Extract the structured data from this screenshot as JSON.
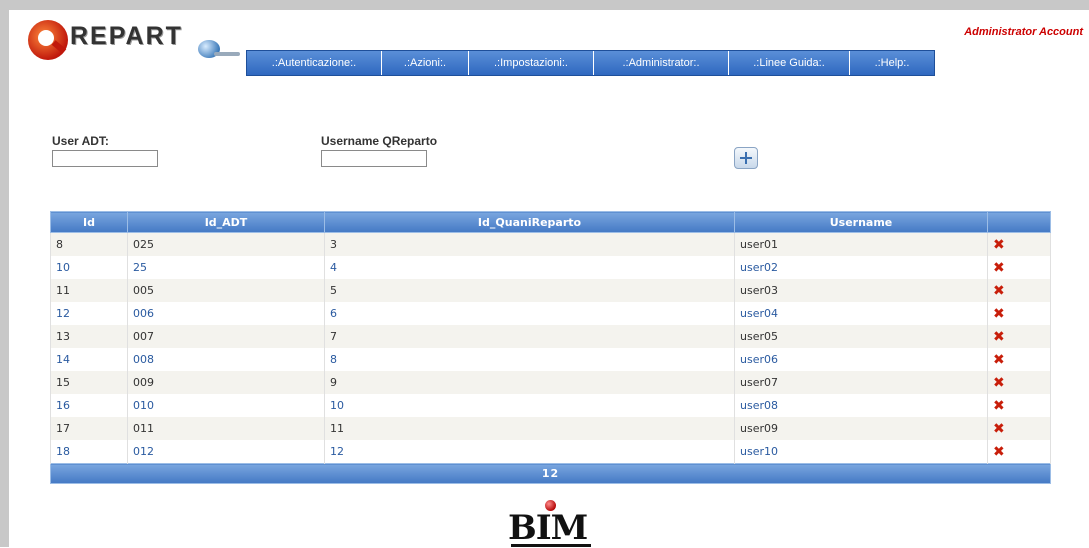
{
  "app": {
    "logo_text": "REPART",
    "account_label": "Administrator Account"
  },
  "menu": [
    {
      "label": ".:Autenticazione:."
    },
    {
      "label": ".:Azioni:."
    },
    {
      "label": ".:Impostazioni:."
    },
    {
      "label": ".:Administrator:."
    },
    {
      "label": ".:Linee Guida:."
    },
    {
      "label": ".:Help:."
    }
  ],
  "form": {
    "user_adt_label": "User ADT:",
    "user_adt_value": "",
    "username_label": "Username QReparto",
    "username_value": "",
    "add_button_icon": "plus-icon"
  },
  "table": {
    "columns": [
      "Id",
      "Id_ADT",
      "Id_QuaniReparto",
      "Username",
      ""
    ],
    "rows": [
      {
        "id": "8",
        "id_adt": "025",
        "id_q": "3",
        "username": "user01"
      },
      {
        "id": "10",
        "id_adt": "25",
        "id_q": "4",
        "username": "user02"
      },
      {
        "id": "11",
        "id_adt": "005",
        "id_q": "5",
        "username": "user03"
      },
      {
        "id": "12",
        "id_adt": "006",
        "id_q": "6",
        "username": "user04"
      },
      {
        "id": "13",
        "id_adt": "007",
        "id_q": "7",
        "username": "user05"
      },
      {
        "id": "14",
        "id_adt": "008",
        "id_q": "8",
        "username": "user06"
      },
      {
        "id": "15",
        "id_adt": "009",
        "id_q": "9",
        "username": "user07"
      },
      {
        "id": "16",
        "id_adt": "010",
        "id_q": "10",
        "username": "user08"
      },
      {
        "id": "17",
        "id_adt": "011",
        "id_q": "11",
        "username": "user09"
      },
      {
        "id": "18",
        "id_adt": "012",
        "id_q": "12",
        "username": "user10"
      }
    ],
    "delete_icon": "delete-x-icon",
    "pager": [
      "1",
      "2"
    ]
  },
  "footer": {
    "brand": "BIM"
  },
  "colors": {
    "accent": "#4479c4",
    "account_label": "#cc0000",
    "delete": "#c81e0a",
    "link_row": "#2a5aa0"
  }
}
